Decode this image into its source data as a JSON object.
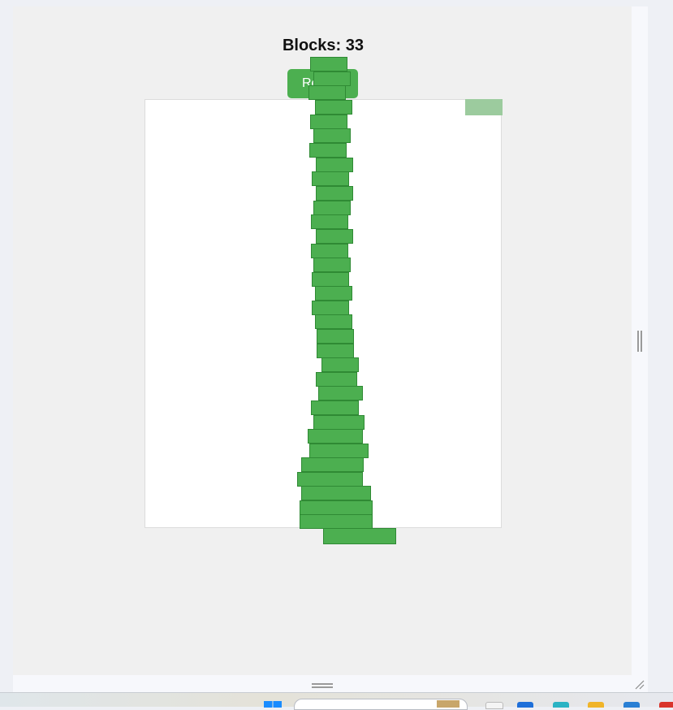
{
  "game": {
    "title": "Blocks: 33",
    "reset_label": "Re",
    "block_count": 33
  },
  "colors": {
    "block": "#4caf50",
    "block_border": "#2f8a34",
    "moving_block": "#9ccb9e",
    "background": "#f0f0f0",
    "canvas": "#ffffff"
  },
  "window": {
    "resize_grip": "resize-grip-icon"
  },
  "taskbar": {
    "icons": [
      "windows-start-icon",
      "search-box",
      "news-widget-icon",
      "app-icon",
      "edge-icon",
      "file-explorer-icon",
      "store-icon",
      "chrome-icon"
    ]
  }
}
